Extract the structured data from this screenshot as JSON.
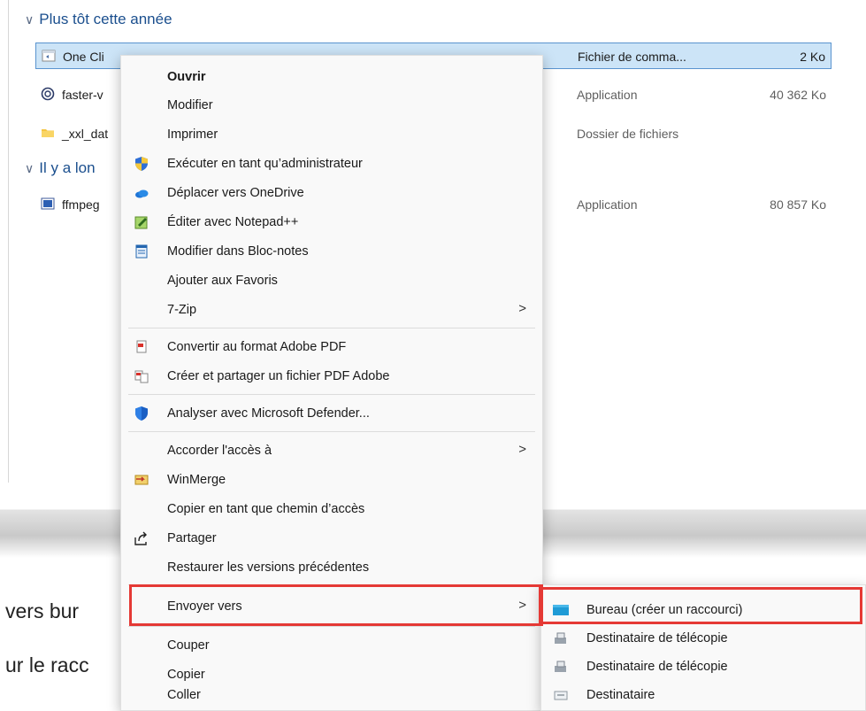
{
  "explorer": {
    "group_this_year": "Plus tôt cette année",
    "group_long_ago": "Il y a lon",
    "rows": [
      {
        "name": "One Cli",
        "type": "Fichier de comma...",
        "size": "2 Ko"
      },
      {
        "name": "faster-v",
        "type": "Application",
        "size": "40 362 Ko"
      },
      {
        "name": "_xxl_dat",
        "type": "Dossier de fichiers",
        "size": ""
      },
      {
        "name": "ffmpeg",
        "type": "Application",
        "size": "80 857 Ko"
      }
    ]
  },
  "article": {
    "line1": "vers bur",
    "line2": "ur le racc"
  },
  "context_menu": {
    "items": [
      {
        "label": "Ouvrir"
      },
      {
        "label": "Modifier"
      },
      {
        "label": "Imprimer"
      },
      {
        "label": "Exécuter en tant qu’administrateur"
      },
      {
        "label": "Déplacer vers OneDrive"
      },
      {
        "label": "Éditer avec Notepad++"
      },
      {
        "label": "Modifier dans Bloc-notes"
      },
      {
        "label": "Ajouter aux Favoris"
      },
      {
        "label": "7-Zip"
      },
      {
        "label": "Convertir au format Adobe PDF"
      },
      {
        "label": "Créer et partager un fichier PDF Adobe"
      },
      {
        "label": "Analyser avec Microsoft Defender..."
      },
      {
        "label": "Accorder l'accès à"
      },
      {
        "label": "WinMerge"
      },
      {
        "label": "Copier en tant que chemin d’accès"
      },
      {
        "label": "Partager"
      },
      {
        "label": "Restaurer les versions précédentes"
      },
      {
        "label": "Envoyer vers"
      },
      {
        "label": "Couper"
      },
      {
        "label": "Copier"
      },
      {
        "label": "Coller"
      }
    ],
    "submenu_arrow": ">"
  },
  "send_to_menu": {
    "items": [
      {
        "label": "Bureau (créer un raccourci)"
      },
      {
        "label": "Destinataire de télécopie"
      },
      {
        "label": "Destinataire de télécopie"
      },
      {
        "label": "Destinataire"
      }
    ]
  },
  "highlight_color": "#e53935"
}
